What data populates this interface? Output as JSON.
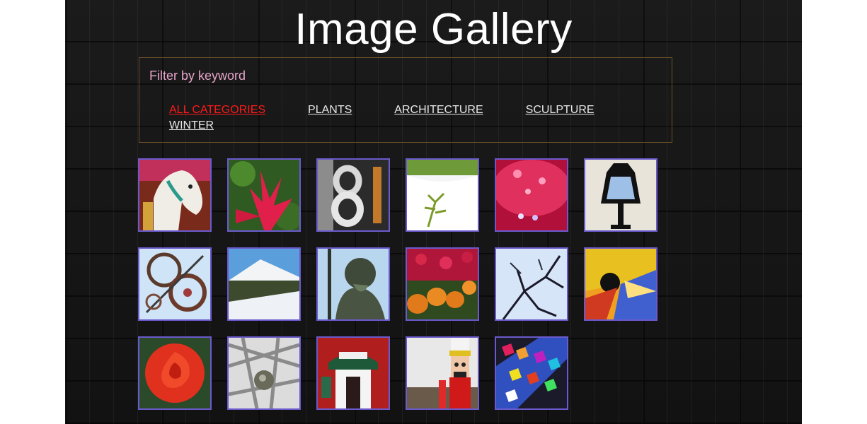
{
  "page": {
    "title": "Image Gallery"
  },
  "filter": {
    "label": "Filter by keyword",
    "categories": [
      {
        "label": "ALL CATEGORIES",
        "active": true
      },
      {
        "label": "PLANTS",
        "active": false
      },
      {
        "label": "ARCHITECTURE",
        "active": false
      },
      {
        "label": "SCULPTURE",
        "active": false
      },
      {
        "label": "WINTER",
        "active": false
      }
    ]
  },
  "gallery": {
    "thumbnails": [
      {
        "subject": "carousel-horse"
      },
      {
        "subject": "red-bromeliad"
      },
      {
        "subject": "metal-number-eight"
      },
      {
        "subject": "sprout-in-snow"
      },
      {
        "subject": "pink-lights"
      },
      {
        "subject": "street-lantern"
      },
      {
        "subject": "metal-wheel-sculpture"
      },
      {
        "subject": "snowy-mountain"
      },
      {
        "subject": "neptune-statue"
      },
      {
        "subject": "pumpkins-and-flowers"
      },
      {
        "subject": "snowy-branches"
      },
      {
        "subject": "colorful-abstract"
      },
      {
        "subject": "red-rose"
      },
      {
        "subject": "metal-truss-ornament"
      },
      {
        "subject": "storefront-in-snow"
      },
      {
        "subject": "nutcracker"
      },
      {
        "subject": "mosaic-tiles"
      }
    ]
  },
  "colors": {
    "background": "#161616",
    "title": "#ffffff",
    "filter_label": "#e6a4c8",
    "category_link": "#e8e8e8",
    "category_active": "#ff1a1a",
    "thumb_border": "#6a5acd",
    "filter_border": "#6a4f2a"
  }
}
